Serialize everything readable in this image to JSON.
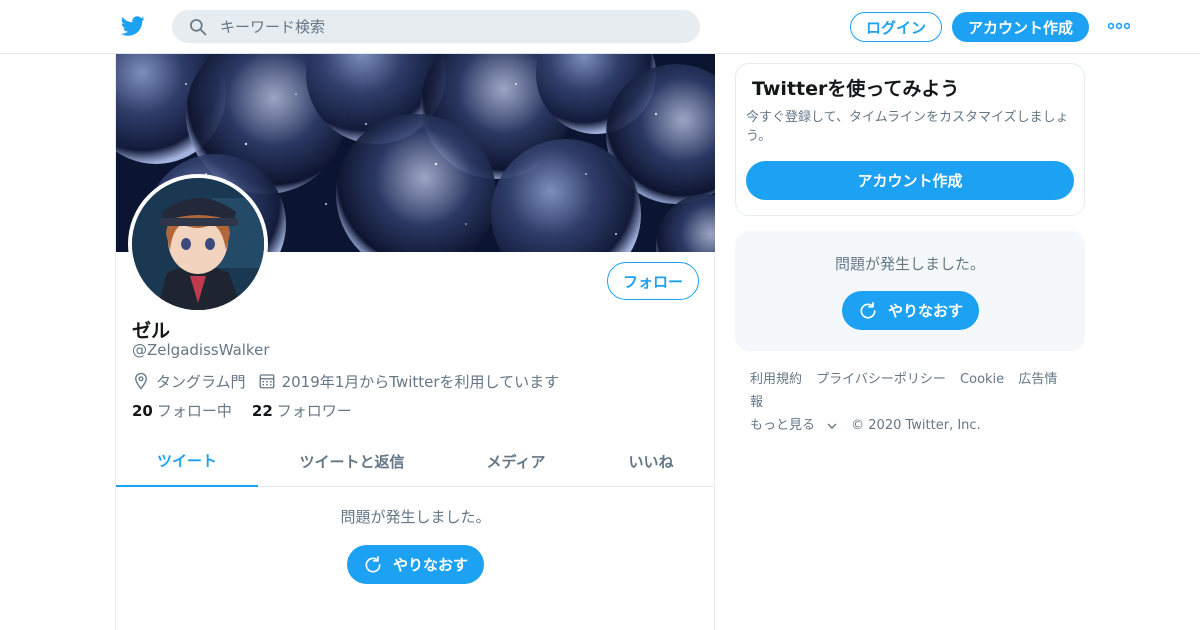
{
  "nav": {
    "search_placeholder": "キーワード検索",
    "login": "ログイン",
    "signup": "アカウント作成"
  },
  "profile": {
    "display_name": "ゼル",
    "handle": "@ZelgadissWalker",
    "location": "タングラム門",
    "joined": "2019年1月からTwitterを利用しています",
    "following_count": "20",
    "following_label": "フォロー中",
    "followers_count": "22",
    "followers_label": "フォロワー",
    "follow_button": "フォロー"
  },
  "tabs": [
    {
      "label": "ツイート",
      "active": true
    },
    {
      "label": "ツイートと返信",
      "active": false
    },
    {
      "label": "メディア",
      "active": false
    },
    {
      "label": "いいね",
      "active": false
    }
  ],
  "timeline": {
    "error": "問題が発生しました。",
    "retry": "やりなおす"
  },
  "sidebar": {
    "signup_title": "Twitterを使ってみよう",
    "signup_desc": "今すぐ登録して、タイムラインをカスタマイズしましょう。",
    "signup_button": "アカウント作成",
    "error": "問題が発生しました。",
    "retry": "やりなおす"
  },
  "footer": {
    "links": [
      "利用規約",
      "プライバシーポリシー",
      "Cookie",
      "広告情報"
    ],
    "more": "もっと見る",
    "copyright": "© 2020 Twitter, Inc."
  },
  "colors": {
    "accent": "#1da1f2",
    "secondary_text": "#657786",
    "border": "#e6ecf0"
  },
  "icons": [
    "twitter-bird-icon",
    "search-icon",
    "more-icon",
    "location-icon",
    "calendar-icon",
    "refresh-icon",
    "chevron-down-icon"
  ]
}
